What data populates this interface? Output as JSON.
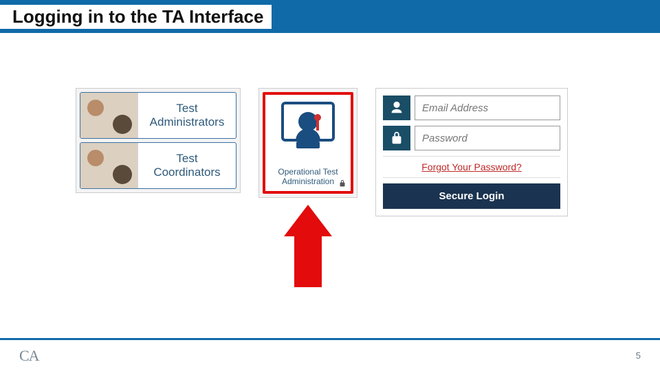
{
  "header": {
    "title": "Logging in to the TA Interface"
  },
  "role_panel": {
    "items": [
      {
        "label": "Test Administrators"
      },
      {
        "label": "Test Coordinators"
      }
    ]
  },
  "app_card": {
    "label": "Operational Test Administration"
  },
  "login": {
    "email_placeholder": "Email Address",
    "password_placeholder": "Password",
    "forgot": "Forgot Your Password?",
    "button": "Secure Login"
  },
  "footer": {
    "logo_text": "CA",
    "page_number": "5"
  },
  "colors": {
    "brand_blue": "#106aa8",
    "highlight_red": "#e30b0b",
    "dark_navy": "#1a3350"
  }
}
